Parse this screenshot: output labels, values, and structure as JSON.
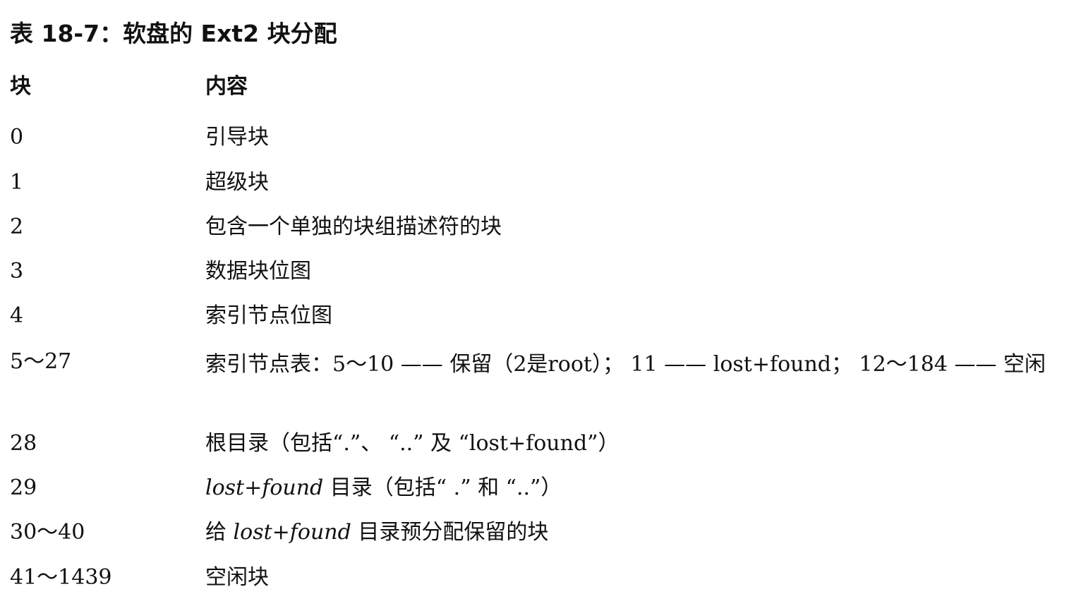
{
  "caption": "表 18-7：软盘的 Ext2 块分配",
  "table": {
    "headers": {
      "block": "块",
      "content": "内容"
    },
    "rows": [
      {
        "block": "0",
        "content": "引导块"
      },
      {
        "block": "1",
        "content": "超级块"
      },
      {
        "block": "2",
        "content": "包含一个单独的块组描述符的块"
      },
      {
        "block": "3",
        "content": "数据块位图"
      },
      {
        "block": "4",
        "content": "索引节点位图"
      },
      {
        "block": "5～27",
        "content": "索引节点表：5～10 —— 保留（2是root）； 11 —— lost+found； 12～184 —— 空闲"
      },
      {
        "block": "28",
        "content": "根目录（包括“.”、 “..” 及 “lost+found”）"
      },
      {
        "block": "29",
        "content_italic": "lost+found",
        "content": " 目录（包括“ .” 和 “..”）"
      },
      {
        "block": "30～40",
        "content_pre": "给 ",
        "content_italic": "lost+found",
        "content": " 目录预分配保留的块"
      },
      {
        "block": "41～1439",
        "content": "空闲块"
      }
    ]
  }
}
